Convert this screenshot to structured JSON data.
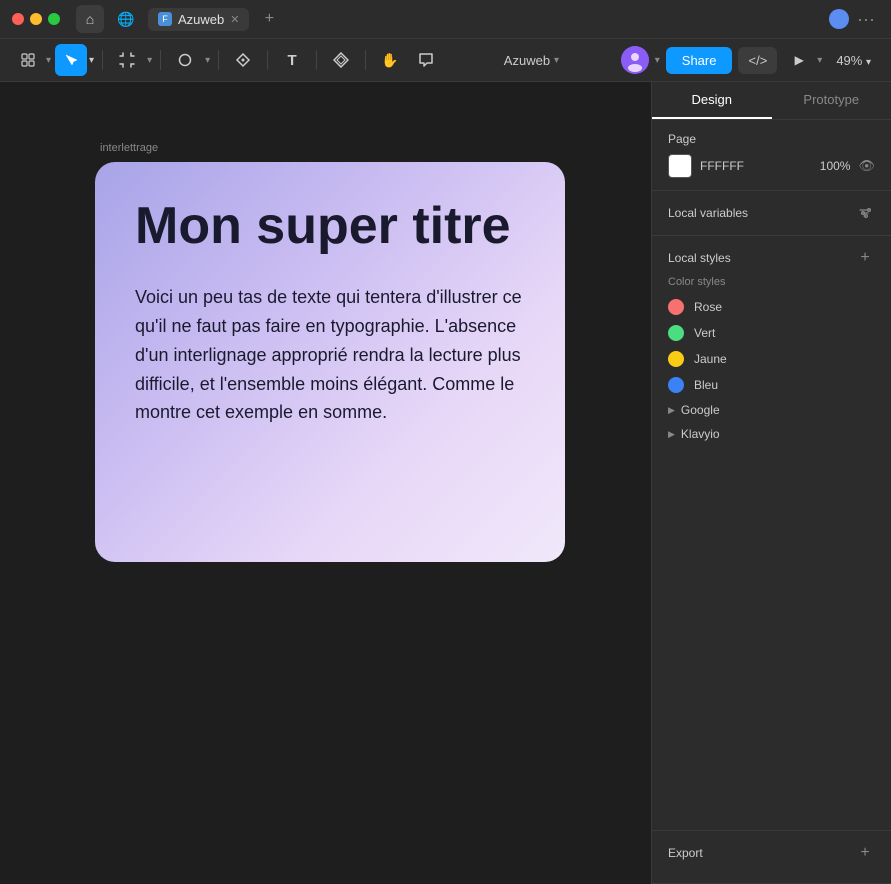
{
  "titlebar": {
    "tabs": [
      {
        "label": "Azuweb",
        "active": true
      }
    ],
    "more": "···"
  },
  "toolbar": {
    "tools": [
      {
        "id": "select-group",
        "icon": "⊕",
        "active": false
      },
      {
        "id": "move",
        "icon": "↖",
        "active": true
      },
      {
        "id": "frame",
        "icon": "⊞",
        "active": false
      },
      {
        "id": "shape",
        "icon": "○",
        "active": false
      },
      {
        "id": "pen",
        "icon": "✒",
        "active": false
      },
      {
        "id": "text",
        "icon": "T",
        "active": false
      },
      {
        "id": "component",
        "icon": "❖",
        "active": false
      },
      {
        "id": "hand",
        "icon": "✋",
        "active": false
      },
      {
        "id": "comment",
        "icon": "💬",
        "active": false
      }
    ],
    "file_name": "Azuweb",
    "share_label": "Share",
    "code_label": "</>",
    "zoom_label": "49%"
  },
  "canvas": {
    "label": "interlettrage",
    "card": {
      "title": "Mon super titre",
      "body": "Voici un peu tas de texte qui tentera d'illustrer ce qu'il ne faut pas faire en typographie. L'absence d'un interlignage approprié rendra la lecture plus difficile, et l'ensemble moins élégant. Comme le montre cet exemple en somme."
    }
  },
  "right_panel": {
    "tabs": [
      {
        "label": "Design",
        "active": true
      },
      {
        "label": "Prototype",
        "active": false
      }
    ],
    "page_section": {
      "title": "Page",
      "color_value": "FFFFFF",
      "opacity": "100%"
    },
    "local_variables": {
      "title": "Local variables"
    },
    "local_styles": {
      "title": "Local styles",
      "color_styles_subtitle": "Color styles",
      "colors": [
        {
          "name": "Rose",
          "color": "#f87171"
        },
        {
          "name": "Vert",
          "color": "#4ade80"
        },
        {
          "name": "Jaune",
          "color": "#facc15"
        },
        {
          "name": "Bleu",
          "color": "#3b82f6"
        }
      ],
      "groups": [
        {
          "name": "Google"
        },
        {
          "name": "Klavyio"
        }
      ]
    },
    "export": {
      "title": "Export"
    }
  }
}
